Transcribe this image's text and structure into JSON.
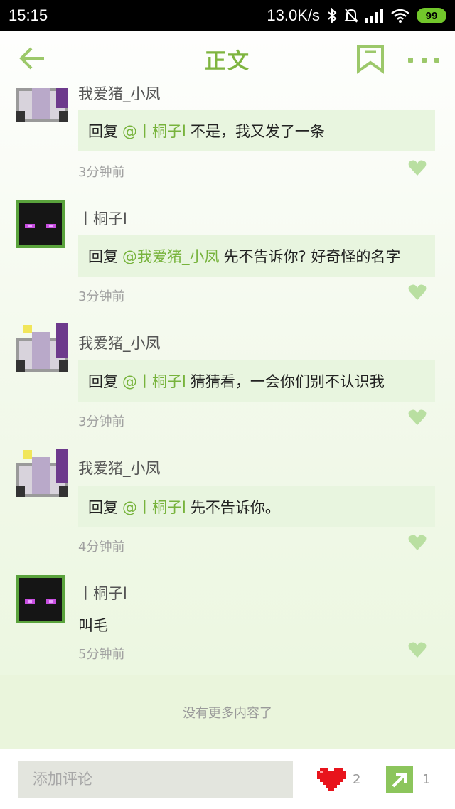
{
  "status": {
    "time": "15:15",
    "network_speed": "13.0K/s",
    "battery": "99",
    "icons": [
      "bluetooth-icon",
      "mute-icon",
      "signal-icon",
      "wifi-icon",
      "battery-icon"
    ]
  },
  "header": {
    "title": "正文",
    "icons": [
      "back-arrow-icon",
      "bookmark-icon",
      "more-icon"
    ],
    "accent_color": "#7fb540"
  },
  "comments": [
    {
      "username": "我爱猪_小凤",
      "avatar": "pig-avatar",
      "reply_prefix": "回复",
      "reply_target": "@丨桐子l",
      "text": "不是，我又发了一条",
      "time": "3分钟前"
    },
    {
      "username": "丨桐子l",
      "avatar": "enderman-avatar",
      "reply_prefix": "回复",
      "reply_target": "@我爱猪_小凤",
      "text": "先不告诉你? 好奇怪的名字",
      "time": "3分钟前"
    },
    {
      "username": "我爱猪_小凤",
      "avatar": "pig-avatar",
      "reply_prefix": "回复",
      "reply_target": "@丨桐子l",
      "text": "猜猜看，一会你们别不认识我",
      "time": "3分钟前"
    },
    {
      "username": "我爱猪_小凤",
      "avatar": "pig-avatar",
      "reply_prefix": "回复",
      "reply_target": "@丨桐子l",
      "text": "先不告诉你。",
      "time": "4分钟前"
    },
    {
      "username": "丨桐子l",
      "avatar": "enderman-avatar",
      "text": "叫毛",
      "time": "5分钟前"
    }
  ],
  "end_message": "没有更多内容了",
  "bottom": {
    "comment_placeholder": "添加评论",
    "likes": "2",
    "shares": "1"
  }
}
